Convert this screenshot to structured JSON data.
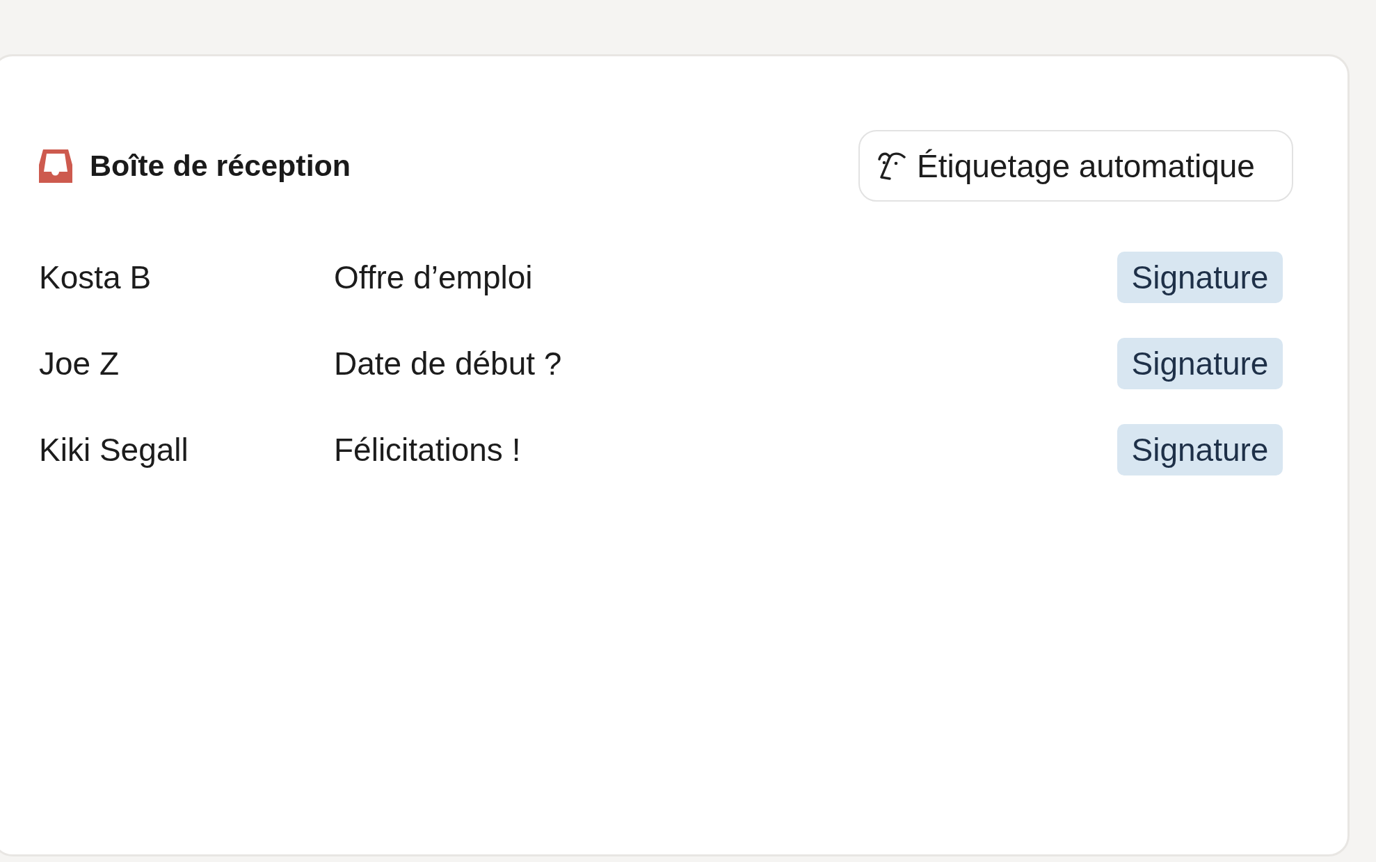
{
  "header": {
    "title": "Boîte de réception",
    "action_button": "Étiquetage automatique"
  },
  "messages": [
    {
      "sender": "Kosta B",
      "subject": "Offre d’emploi",
      "tag": "Signature"
    },
    {
      "sender": "Joe Z",
      "subject": "Date de début ?",
      "tag": "Signature"
    },
    {
      "sender": "Kiki Segall",
      "subject": "Félicitations !",
      "tag": "Signature"
    }
  ]
}
